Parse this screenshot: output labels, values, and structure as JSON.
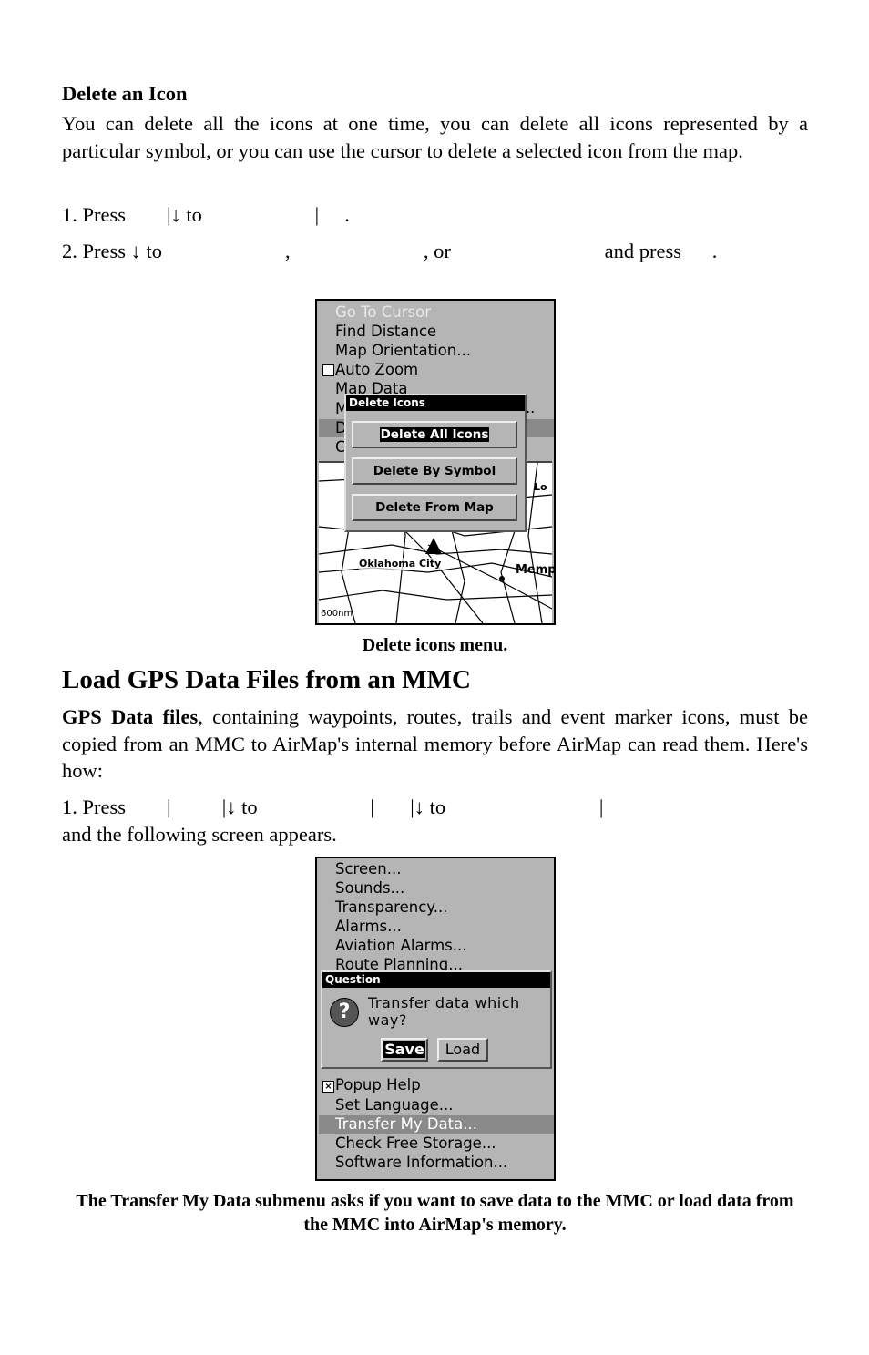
{
  "section1": {
    "heading": "Delete an Icon",
    "intro": "You can delete all the icons at one time, you can delete all icons represented by a particular symbol, or you can use the cursor to delete a selected icon from the map.",
    "step1": "1. Press        |↓ to                      |     .",
    "step2": "2. Press ↓ to                        ,                          , or                              and press      .",
    "caption": "Delete icons menu."
  },
  "screen1": {
    "menu_items": [
      "Go To Cursor",
      "Find Distance",
      "Map Orientation...",
      "Auto Zoom",
      "Map Data",
      "M",
      "D",
      "C"
    ],
    "auto_zoom_checked": false,
    "highlighted_item": "D",
    "dialog_title": "Delete Icons",
    "buttons": [
      "Delete All Icons",
      "Delete By Symbol",
      "Delete From Map"
    ],
    "selected_button": "Delete All Icons",
    "map_labels": {
      "city1": "Oklahoma City",
      "city2": "Memp",
      "city3": "Lo",
      "scale": "600nm"
    }
  },
  "section2": {
    "heading": "Load GPS Data Files from an MMC",
    "intro_bold": "GPS Data files",
    "intro": ", containing waypoints, routes, trails and event marker icons, must be copied from an MMC to AirMap's internal memory before AirMap can read them. Here's how:",
    "step1": "1. Press        |          |↓ to                      |       |↓ to                              |",
    "step1_cont": "and the following screen appears.",
    "caption": "The Transfer My Data submenu asks if you want to save data to the MMC or load data from the MMC into AirMap's memory."
  },
  "screen2": {
    "menu_top": [
      "Screen...",
      "Sounds...",
      "Transparency...",
      "Alarms...",
      "Aviation Alarms...",
      "Route Planning..."
    ],
    "menu_bottom": [
      "Popup Help",
      "Set Language...",
      "Transfer My Data...",
      "Check Free Storage...",
      "Software Information..."
    ],
    "popup_help_checked": true,
    "highlighted_item": "Transfer My Data...",
    "dialog_title": "Question",
    "question": "Transfer data which way?",
    "buttons": [
      "Save",
      "Load"
    ],
    "selected_button": "Save",
    "colors": {
      "screen_bg": "#b5b5b5",
      "highlight": "#8a8a8a"
    }
  }
}
